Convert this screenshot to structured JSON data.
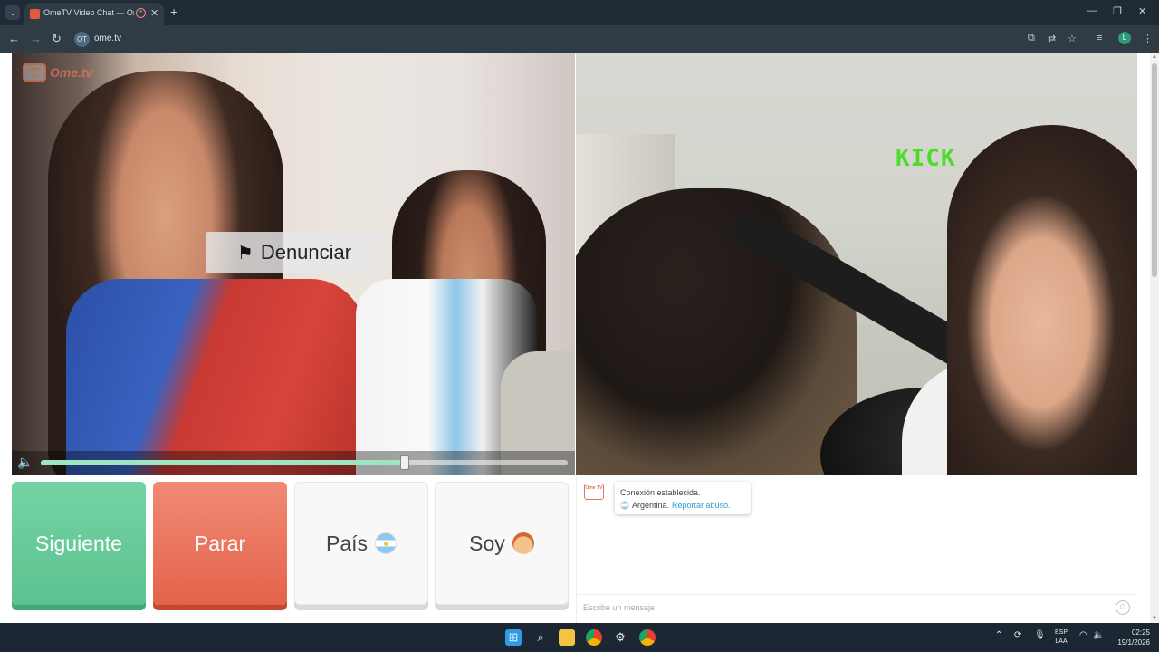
{
  "browser": {
    "tab_title": "OmeTV Video Chat — Ome",
    "tab_close": "✕",
    "new_tab": "+",
    "url": "ome.tv",
    "site_badge": "OT",
    "profile_initial": "L",
    "window_controls": [
      "—",
      "❐",
      "✕"
    ]
  },
  "video_left": {
    "logo_text": "Ome.tv",
    "logo_tv": "Ome TV",
    "report_label": "Denunciar",
    "volume_percent": 69
  },
  "video_right": {
    "overlay_tag": "KICK"
  },
  "controls": {
    "next_label": "Siguiente",
    "stop_label": "Parar",
    "country_label": "País",
    "gender_label": "Soy"
  },
  "chat": {
    "logo_tv": "Ome TV",
    "status_line": "Conexión establecida.",
    "country": "Argentina.",
    "report_link": "Reportar abuso.",
    "input_placeholder": "Escribe un mensaje"
  },
  "taskbar": {
    "lang_top": "ESP",
    "lang_bottom": "LAA",
    "time": "02:25",
    "date": "19/1/2026"
  },
  "colors": {
    "next": "#5cc290",
    "stop": "#e4634b",
    "accent_link": "#2a9fd0",
    "brand": "#e2765a"
  }
}
